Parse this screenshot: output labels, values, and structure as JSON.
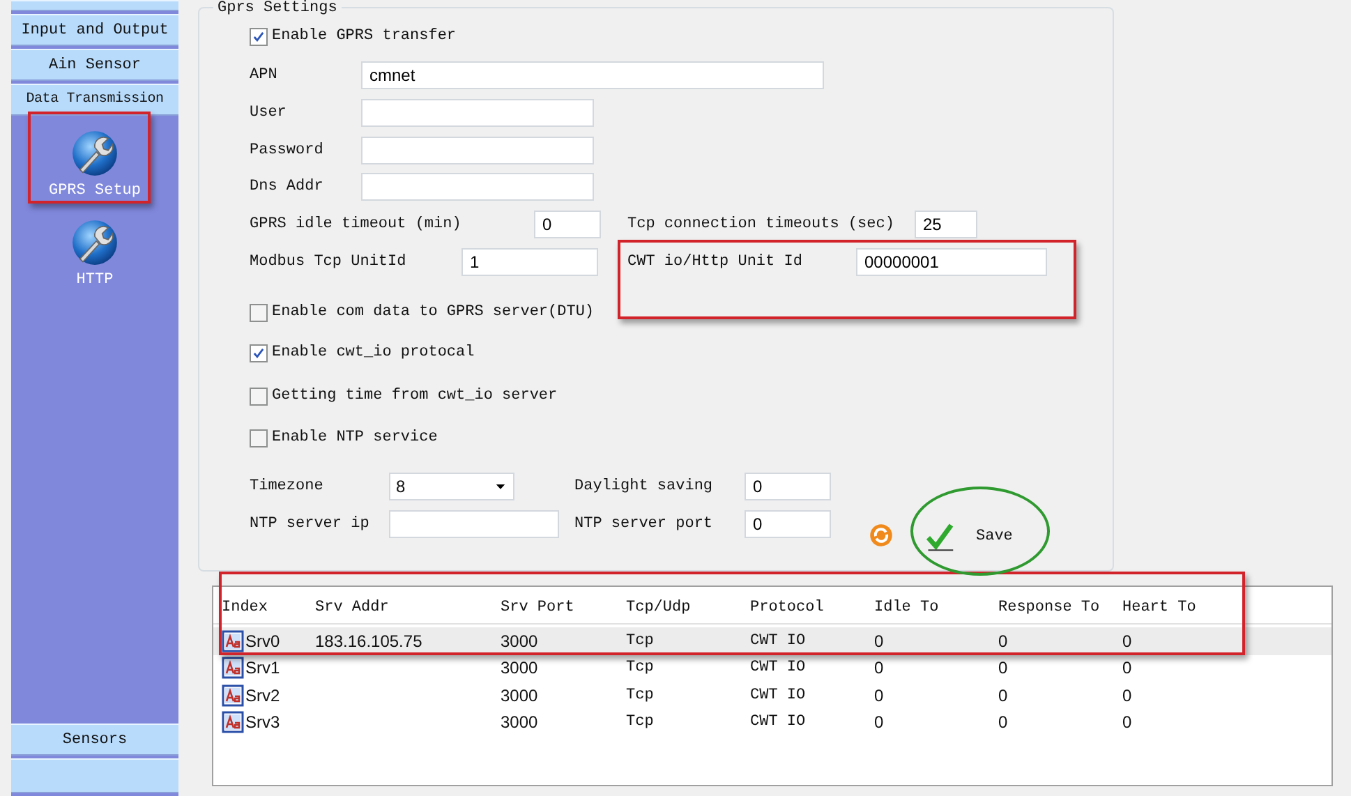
{
  "sidebar": {
    "top_items": [
      {
        "label": "Input and Output"
      },
      {
        "label": "Ain Sensor"
      },
      {
        "label": "Data Transmission"
      }
    ],
    "tools": [
      {
        "label": "GPRS Setup"
      },
      {
        "label": "HTTP"
      }
    ],
    "bottom_items": [
      {
        "label": "Sensors"
      }
    ]
  },
  "gprs_settings": {
    "title": "Gprs Settings",
    "rows": [
      {
        "kind": "checkbox",
        "label": "Enable GPRS transfer",
        "checked": true
      },
      {
        "kind": "fields",
        "fields": [
          {
            "label": "APN",
            "value": "cmnet"
          }
        ]
      },
      {
        "kind": "fields",
        "fields": [
          {
            "label": "User"
          }
        ]
      },
      {
        "kind": "fields",
        "fields": [
          {
            "label": "Password"
          }
        ]
      },
      {
        "kind": "fields",
        "fields": [
          {
            "label": "Dns Addr"
          }
        ]
      },
      {
        "kind": "fields",
        "fields": [
          {
            "label": "GPRS idle timeout (min)",
            "value": "0"
          },
          {
            "label": "Tcp connection timeouts (sec)",
            "value": "25"
          }
        ]
      },
      {
        "kind": "fields",
        "fields": [
          {
            "label": "Modbus Tcp UnitId",
            "value": "1"
          },
          {
            "label": "CWT io/Http Unit Id",
            "value": "00000001"
          }
        ]
      },
      {
        "kind": "checkbox",
        "label": "Enable com data to GPRS server(DTU)",
        "checked": false
      },
      {
        "kind": "checkbox",
        "label": "Enable cwt_io protocal",
        "checked": true
      },
      {
        "kind": "checkbox",
        "label": "Getting time from cwt_io server",
        "checked": false
      },
      {
        "kind": "checkbox",
        "label": "Enable NTP service",
        "checked": false
      },
      {
        "kind": "fields",
        "fields": [
          {
            "label": "Timezone",
            "value": "8",
            "kind": "dropdown"
          },
          {
            "label": "Daylight saving",
            "value": "0",
            "kind": "text"
          }
        ]
      },
      {
        "kind": "fields",
        "fields": [
          {
            "label": "NTP server ip",
            "kind": "text"
          },
          {
            "label": "NTP server port",
            "value": "0",
            "kind": "text"
          }
        ]
      }
    ],
    "buttons": [
      {
        "kind": "refresh"
      },
      {
        "kind": "save",
        "label": "Save"
      }
    ]
  },
  "server_table": {
    "columns": [
      "Index",
      "Srv Addr",
      "Srv Port",
      "Tcp/Udp",
      "Protocol",
      "Idle To",
      "Response To",
      "Heart To"
    ],
    "rows": [
      {
        "selected": true,
        "cells": [
          "Srv0",
          "183.16.105.75",
          "3000",
          "Tcp",
          "CWT IO",
          "0",
          "0",
          "0"
        ]
      },
      {
        "selected": false,
        "cells": [
          "Srv1",
          "",
          "3000",
          "Tcp",
          "CWT IO",
          "0",
          "0",
          "0"
        ]
      },
      {
        "selected": false,
        "cells": [
          "Srv2",
          "",
          "3000",
          "Tcp",
          "CWT IO",
          "0",
          "0",
          "0"
        ]
      },
      {
        "selected": false,
        "cells": [
          "Srv3",
          "",
          "3000",
          "Tcp",
          "CWT IO",
          "0",
          "0",
          "0"
        ]
      }
    ]
  }
}
